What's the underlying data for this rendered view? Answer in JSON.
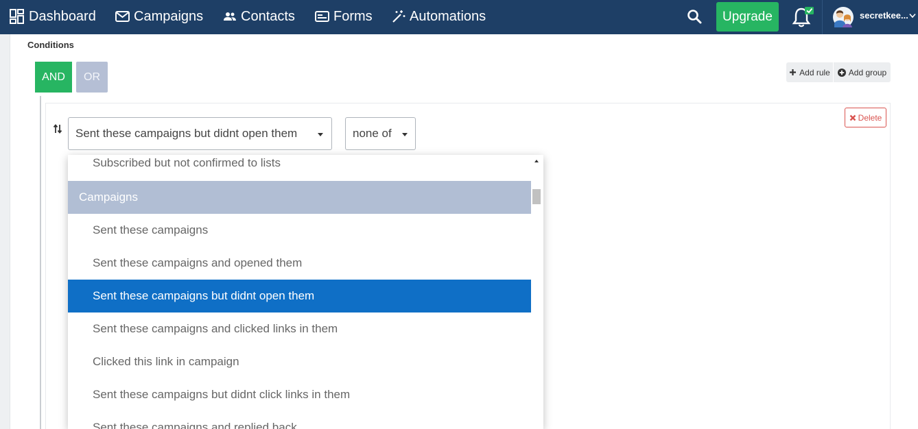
{
  "nav": {
    "items": [
      {
        "label": "Dashboard",
        "icon": "dashboard-icon"
      },
      {
        "label": "Campaigns",
        "icon": "envelope-icon"
      },
      {
        "label": "Contacts",
        "icon": "users-icon"
      },
      {
        "label": "Forms",
        "icon": "form-icon"
      },
      {
        "label": "Automations",
        "icon": "magic-wand-icon"
      }
    ],
    "upgrade_label": "Upgrade",
    "username": "secretkee..."
  },
  "conditions": {
    "label": "Conditions",
    "and_label": "AND",
    "or_label": "OR",
    "add_rule_label": "Add rule",
    "add_group_label": "Add group"
  },
  "rule": {
    "field_value": "Sent these campaigns but didnt open them",
    "operator_value": "none of",
    "delete_label": "Delete"
  },
  "dropdown": {
    "items": [
      {
        "label": "Subscribed but not confirmed to lists",
        "type": "option"
      },
      {
        "label": "Campaigns",
        "type": "header"
      },
      {
        "label": "Sent these campaigns",
        "type": "option"
      },
      {
        "label": "Sent these campaigns and opened them",
        "type": "option"
      },
      {
        "label": "Sent these campaigns but didnt open them",
        "type": "option",
        "selected": true
      },
      {
        "label": "Sent these campaigns and clicked links in them",
        "type": "option"
      },
      {
        "label": "Clicked this link in campaign",
        "type": "option"
      },
      {
        "label": "Sent these campaigns but didnt click links in them",
        "type": "option"
      },
      {
        "label": "Sent these campaigns and replied back",
        "type": "option"
      }
    ]
  },
  "colors": {
    "nav_bg": "#1e3f66",
    "accent_green": "#27b562",
    "selected_blue": "#0f6fc6",
    "group_header": "#b1bed4",
    "danger": "#d9534f"
  }
}
